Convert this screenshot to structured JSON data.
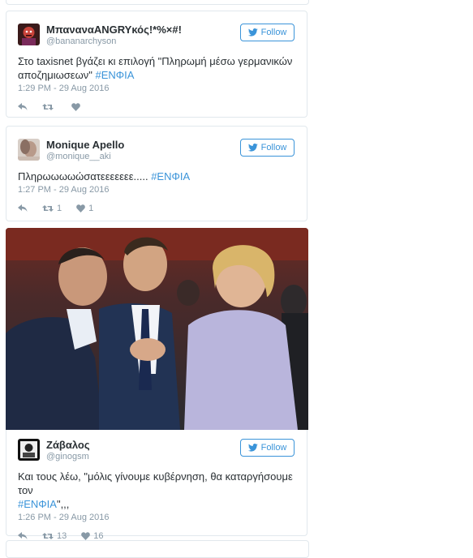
{
  "follow_label": "Follow",
  "colors": {
    "accent": "#3b94d9",
    "muted": "#8899a6",
    "text": "#292f33",
    "border": "#e1e8ed"
  },
  "tweets": [
    {
      "name": "ΜπαναναANGRYκός!*%×#!",
      "handle": "@bananarchyson",
      "text": "Στο taxisnet βγάζει κι επιλογή \"Πληρωμή μέσω γερμανικών αποζημιωσεων\"",
      "hashtag": "#ΕΝΦΙΑ",
      "hashtag_suffix": "",
      "time": "1:29 PM - 29 Aug 2016",
      "retweets": "",
      "likes": "",
      "avatar_icon": "angry-avatar-icon"
    },
    {
      "name": "Monique Apello",
      "handle": "@monique__aki",
      "text": "Πληρωωωωώσατεεεεεεε.....",
      "hashtag": "#ΕΝΦΙΑ",
      "hashtag_suffix": "",
      "time": "1:27 PM - 29 Aug 2016",
      "retweets": "1",
      "likes": "1",
      "avatar_icon": "portrait-avatar-icon"
    },
    {
      "name": "Ζάβαλος",
      "handle": "@ginogsm",
      "text": "Και τους λέω, \"μόλις γίνουμε κυβέρνηση, θα καταργήσουμε τον",
      "hashtag": "#ΕΝΦΙΑ",
      "hashtag_suffix": "\",,,",
      "time": "1:26 PM - 29 Aug 2016",
      "retweets": "13",
      "likes": "16",
      "avatar_icon": "comic-avatar-icon"
    }
  ]
}
